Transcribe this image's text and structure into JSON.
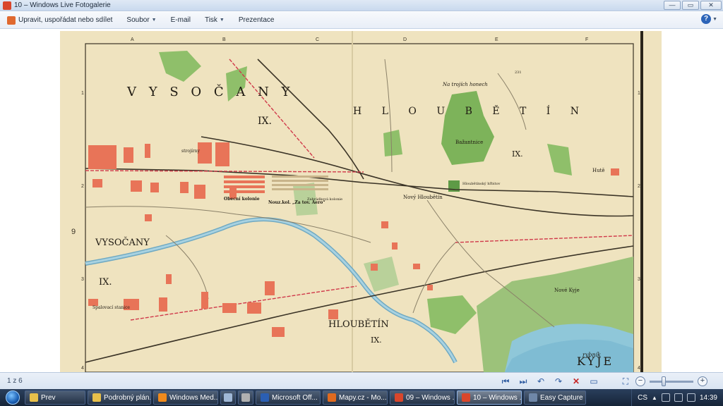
{
  "window": {
    "title": "10 – Windows Live Fotogalerie",
    "buttons": {
      "minimize": "—",
      "maximize": "▭",
      "close": "✕"
    }
  },
  "menubar": {
    "items": [
      {
        "label": "Upravit, uspořádat nebo sdílet",
        "has_icon": true
      },
      {
        "label": "Soubor",
        "dropdown": true
      },
      {
        "label": "E-mail"
      },
      {
        "label": "Tisk",
        "dropdown": true
      },
      {
        "label": "Prezentace"
      }
    ],
    "help": "?"
  },
  "map": {
    "labels": {
      "vysocany_top": "V Y S O Č A N Y",
      "hloubetin_top": "H L O U B Ě T Í N",
      "ix_1": "IX.",
      "ix_2": "IX.",
      "ix_3": "IX.",
      "ix_4": "IX.",
      "ix_5": "IX.",
      "vysocany_mid": "VYSOČANY",
      "hloubetin_low": "HLOUBĚTÍN",
      "kyje": "KYJE",
      "na_trojich_honech": "Na trojích honech",
      "bazantnice": "Bažantnice",
      "novy_hloubetin": "Nový Hloubětín",
      "obecni_kolonie": "Obecní kolonie",
      "nouz_kol": "Nouz.kol. „Za tov. Aero“",
      "zahradkova_kolonie": "Zahrádková kolonie",
      "hloubetinsky_hrbitov": "Hloubětínský hřbitov",
      "hute": "Hutě",
      "strojirny": "strojírny",
      "kyjsky_rybnik": "rybník",
      "nove_kyje": "Nové Kyje",
      "spalovaci_stanice": "Spalovací stanice",
      "elev_231": "231"
    },
    "grid_columns": [
      "A",
      "B",
      "C",
      "D",
      "E",
      "F"
    ],
    "grid_rows": [
      "1",
      "2",
      "3",
      "4"
    ],
    "side_marker": "9"
  },
  "statusbar": {
    "position": "1 z 6",
    "tools": [
      {
        "name": "first",
        "glyph": "⏮"
      },
      {
        "name": "next",
        "glyph": "⏭"
      },
      {
        "name": "rotate-left",
        "glyph": "↶"
      },
      {
        "name": "rotate-right",
        "glyph": "↷"
      },
      {
        "name": "delete",
        "glyph": "✕"
      },
      {
        "name": "slideshow",
        "glyph": "▭"
      },
      {
        "name": "actual-size",
        "glyph": "⛶"
      }
    ],
    "zoom_minus": "−",
    "zoom_plus": "+",
    "zoom_level": 0.3
  },
  "taskbar": {
    "buttons": [
      {
        "label": "Prev",
        "icon_color": "#e8c04a"
      },
      {
        "label": "Podrobný plán...",
        "icon_color": "#e8c04a"
      },
      {
        "label": "Windows Med...",
        "icon_color": "#f08a1c"
      },
      {
        "label": "",
        "icon_color": "#9fb7d6"
      },
      {
        "label": "",
        "icon_color": "#b0b0b0"
      },
      {
        "label": "Microsoft Off...",
        "icon_color": "#2b5fb3"
      },
      {
        "label": "Mapy.cz - Mo...",
        "icon_color": "#e06a1f"
      },
      {
        "label": "09 – Windows ...",
        "icon_color": "#d9462b"
      },
      {
        "label": "10 – Windows ...",
        "icon_color": "#d9462b"
      },
      {
        "label": "Easy Capture ...",
        "icon_color": "#6f87a8"
      }
    ],
    "tray": {
      "language": "CS",
      "time": "14:39"
    }
  }
}
